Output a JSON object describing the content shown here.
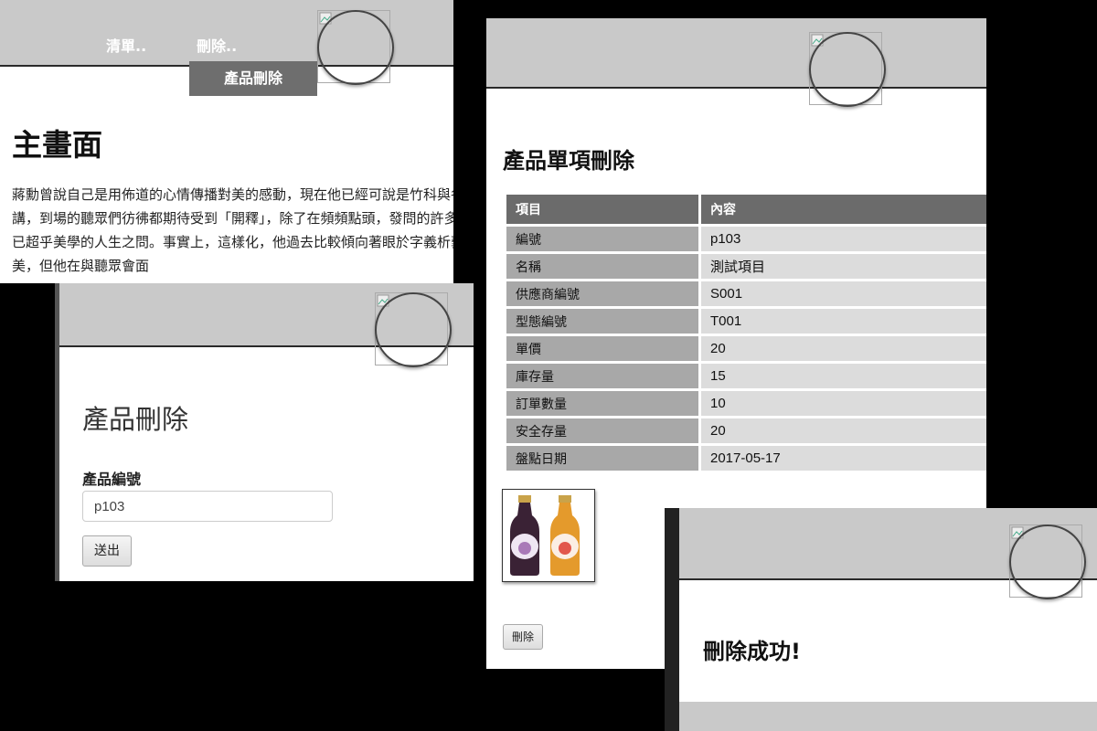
{
  "main": {
    "nav": {
      "list_label": "清單..",
      "delete_label": "刪除.."
    },
    "dropdown": {
      "item_label": "產品刪除"
    },
    "title": "主畫面",
    "paragraph": "蔣勳曾說自己是用佈道的心情傳播對美的感動，現在他已經可說是竹科與各地演講，到場的聽眾們彷彿都期待受到「開釋」，除了在頻頻點頭，發問的許多也都是已超乎美學的人生之問。事實上，這樣化，他過去比較傾向著眼於字義析藝術之美，但他在與聽眾會面"
  },
  "delete_form": {
    "title": "產品刪除",
    "field_label": "產品編號",
    "field_value": "p103",
    "submit_label": "送出"
  },
  "detail": {
    "title": "產品單項刪除",
    "headers": [
      "項目",
      "內容"
    ],
    "rows": [
      [
        "編號",
        "p103"
      ],
      [
        "名稱",
        "測試項目"
      ],
      [
        "供應商編號",
        "S001"
      ],
      [
        "型態編號",
        "T001"
      ],
      [
        "單價",
        "20"
      ],
      [
        "庫存量",
        "15"
      ],
      [
        "訂單數量",
        "10"
      ],
      [
        "安全存量",
        "20"
      ],
      [
        "盤點日期",
        "2017-05-17"
      ]
    ],
    "image_icon": "juice-bottles-image",
    "delete_label": "刪除"
  },
  "success": {
    "message": "刪除成功!"
  },
  "colors": {
    "bar": "#c9c9c9",
    "header_cell": "#6b6b6b",
    "key_cell": "#a8a8a8",
    "value_cell": "#dcdcdc",
    "dropdown": "#6e6e6e"
  }
}
